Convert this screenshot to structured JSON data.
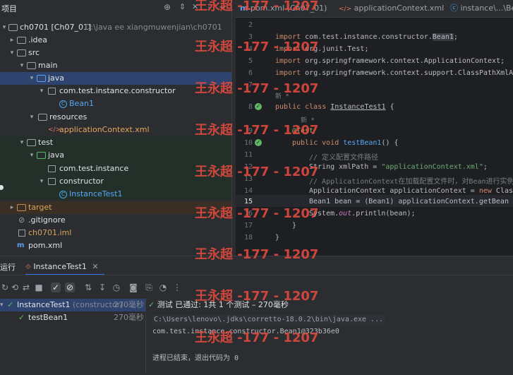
{
  "project_panel": {
    "header_label": "项目",
    "rows": [
      {
        "label": "ch0701 [Ch07_01]",
        "path": "D:\\java ee xiangmuwenjian\\ch0701"
      },
      {
        "label": ".idea"
      },
      {
        "label": "src"
      },
      {
        "label": "main"
      },
      {
        "label": "java"
      },
      {
        "label": "com.test.instance.constructor"
      },
      {
        "label": "Bean1"
      },
      {
        "label": "resources"
      },
      {
        "label": "applicationContext.xml"
      },
      {
        "label": "test"
      },
      {
        "label": "java"
      },
      {
        "label": "com.test.instance"
      },
      {
        "label": "constructor"
      },
      {
        "label": "InstanceTest1"
      },
      {
        "label": "target"
      },
      {
        "label": ".gitignore"
      },
      {
        "label": "ch0701.iml"
      },
      {
        "label": "pom.xml"
      }
    ]
  },
  "editor": {
    "tabs": [
      {
        "label": "pom.xml (Ch07_01)"
      },
      {
        "label": "applicationContext.xml"
      },
      {
        "label": "instance\\...\\Bean1"
      }
    ],
    "line_numbers": [
      "2",
      "3",
      "4",
      "5",
      "6",
      "7",
      "8",
      "",
      "9",
      "10",
      "11",
      "12",
      "13",
      "14",
      "15",
      "16",
      "17",
      "18"
    ],
    "new_hint": "新 *",
    "lines": {
      "l3": [
        "import ",
        "com.test.instance.constructor.",
        "Bean1",
        ";"
      ],
      "l4": [
        "import ",
        "org.junit.",
        "Test",
        ";"
      ],
      "l5": [
        "import ",
        "org.springframework.context.ApplicationContext;"
      ],
      "l6": [
        "import ",
        "org.springframework.context.support.ClassPathXmlA"
      ],
      "l8": [
        "public class ",
        "InstanceTest1",
        " {"
      ],
      "l9": "@Test",
      "l10": [
        "public void ",
        "testBean1",
        "() {"
      ],
      "l11": "// 定义配置文件路径",
      "l12": [
        "String xmlPath = ",
        "\"applicationContext.xml\"",
        ";"
      ],
      "l13": "// ApplicationContext在加载配置文件时，对Bean进行实例",
      "l14": [
        "ApplicationContext applicationContext = ",
        "new ",
        "Clas"
      ],
      "l15": "Bean1 bean = (Bean1) applicationContext.getBean",
      "l16": [
        "System.",
        "out",
        ".println(bean);"
      ],
      "l17": "}",
      "l18": "}"
    }
  },
  "run_panel": {
    "tab_label_run": "运行",
    "tab_label_config": "InstanceTest1",
    "tree": [
      {
        "label": "InstanceTest1",
        "sub": "(constructor)",
        "time": "270毫秒"
      },
      {
        "label": "testBean1",
        "time": "270毫秒"
      }
    ],
    "status": "测试 已通过: 1共 1 个测试 – 270毫秒",
    "console_lines": [
      "C:\\Users\\lenovo\\.jdks\\corretto-18.0.2\\bin\\java.exe ...",
      "com.test.instance.constructor.Bean1@323b36e0",
      "",
      "进程已结束，退出代码为 0"
    ]
  },
  "watermark": "王永超 -177 - 1207",
  "colors": {
    "accent": "#3574f0",
    "pass": "#5fb865",
    "watermark": "#e04a3f"
  }
}
